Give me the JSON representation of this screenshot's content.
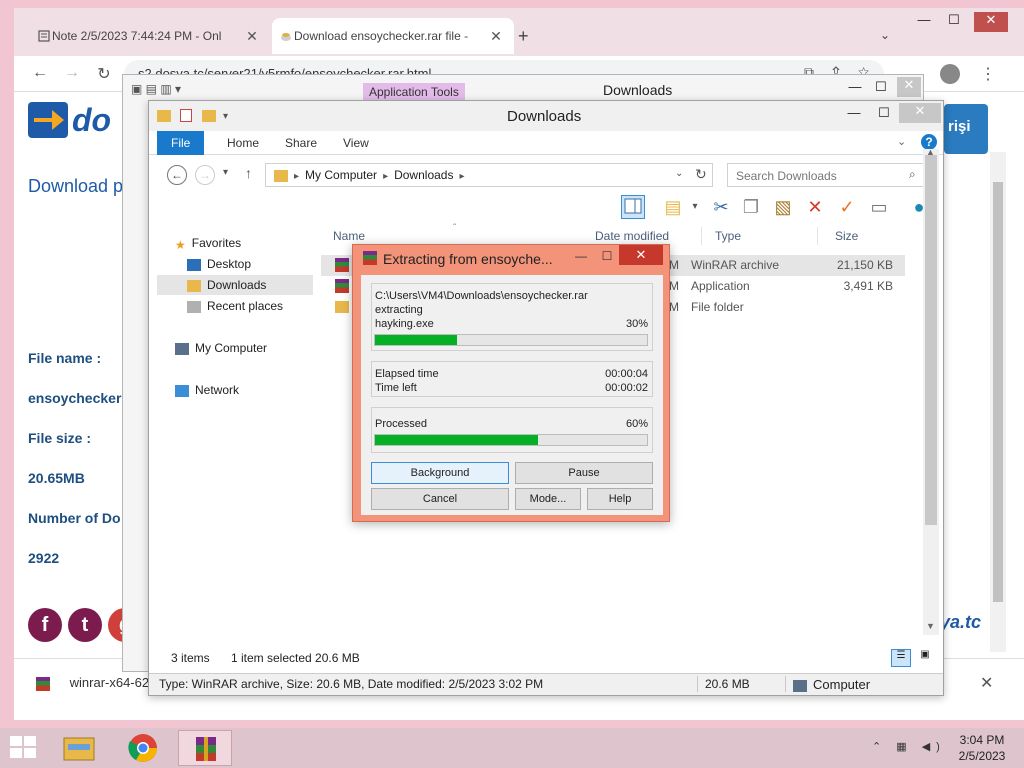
{
  "browser": {
    "tabs": [
      {
        "title": "Note 2/5/2023 7:44:24 PM - Onl",
        "icon": "note-icon"
      },
      {
        "title": "Download ensoychecker.rar file -",
        "icon": "dosya-icon"
      }
    ],
    "new_tab": "+",
    "url": "s2.dosya.tc/server21/y5rmfo/ensoychecker.rar.html",
    "window_controls": {
      "minimize": "—",
      "maximize": "☐",
      "close": "✕"
    }
  },
  "webpage": {
    "logo_text": "do",
    "download_title": "Download p",
    "labels": [
      "File name :",
      "ensoychecker",
      "File size :",
      "20.65MB",
      "Number of Do",
      "2922"
    ],
    "login_button": "rişi",
    "brand_suffix": "ya.tc"
  },
  "download_bar": {
    "item": "winrar-x64-62",
    "close": "✕"
  },
  "explorer_back": {
    "app_tools": "Application Tools",
    "title": "Downloads"
  },
  "explorer": {
    "title": "Downloads",
    "ribbon_tabs": {
      "file": "File",
      "home": "Home",
      "share": "Share",
      "view": "View"
    },
    "address": {
      "seg1": "My Computer",
      "seg2": "Downloads"
    },
    "search_placeholder": "Search Downloads",
    "nav": {
      "favorites": "Favorites",
      "desktop": "Desktop",
      "downloads": "Downloads",
      "recent": "Recent places",
      "computer": "My Computer",
      "network": "Network"
    },
    "columns": {
      "name": "Name",
      "date": "Date modified",
      "type": "Type",
      "size": "Size"
    },
    "files": [
      {
        "date": "PM",
        "type": "WinRAR archive",
        "size": "21,150 KB"
      },
      {
        "date": "PM",
        "type": "Application",
        "size": "3,491 KB"
      },
      {
        "date": "PM",
        "type": "File folder",
        "size": ""
      }
    ],
    "status": {
      "items": "3 items",
      "selected": "1 item selected  20.6 MB"
    },
    "details": {
      "info": "Type: WinRAR archive, Size: 20.6 MB, Date modified: 2/5/2023 3:02 PM",
      "size": "20.6 MB",
      "location": "Computer"
    }
  },
  "rar_dialog": {
    "title": "Extracting from ensoyche...",
    "archive_path": "C:\\Users\\VM4\\Downloads\\ensoychecker.rar",
    "action": "extracting",
    "current_file": "hayking.exe",
    "file_progress_label": "30%",
    "file_progress": 0.3,
    "elapsed_label": "Elapsed time",
    "elapsed": "00:00:04",
    "left_label": "Time left",
    "left": "00:00:02",
    "processed_label": "Processed",
    "processed_pct_label": "60%",
    "processed_progress": 0.6,
    "buttons": {
      "background": "Background",
      "pause": "Pause",
      "cancel": "Cancel",
      "mode": "Mode...",
      "help": "Help"
    }
  },
  "taskbar": {
    "time": "3:04 PM",
    "date": "2/5/2023"
  },
  "colors": {
    "accent": "#1979ca",
    "progress": "#06b025",
    "rar_frame": "#f2937a",
    "desktop": "#f1c6d2"
  }
}
